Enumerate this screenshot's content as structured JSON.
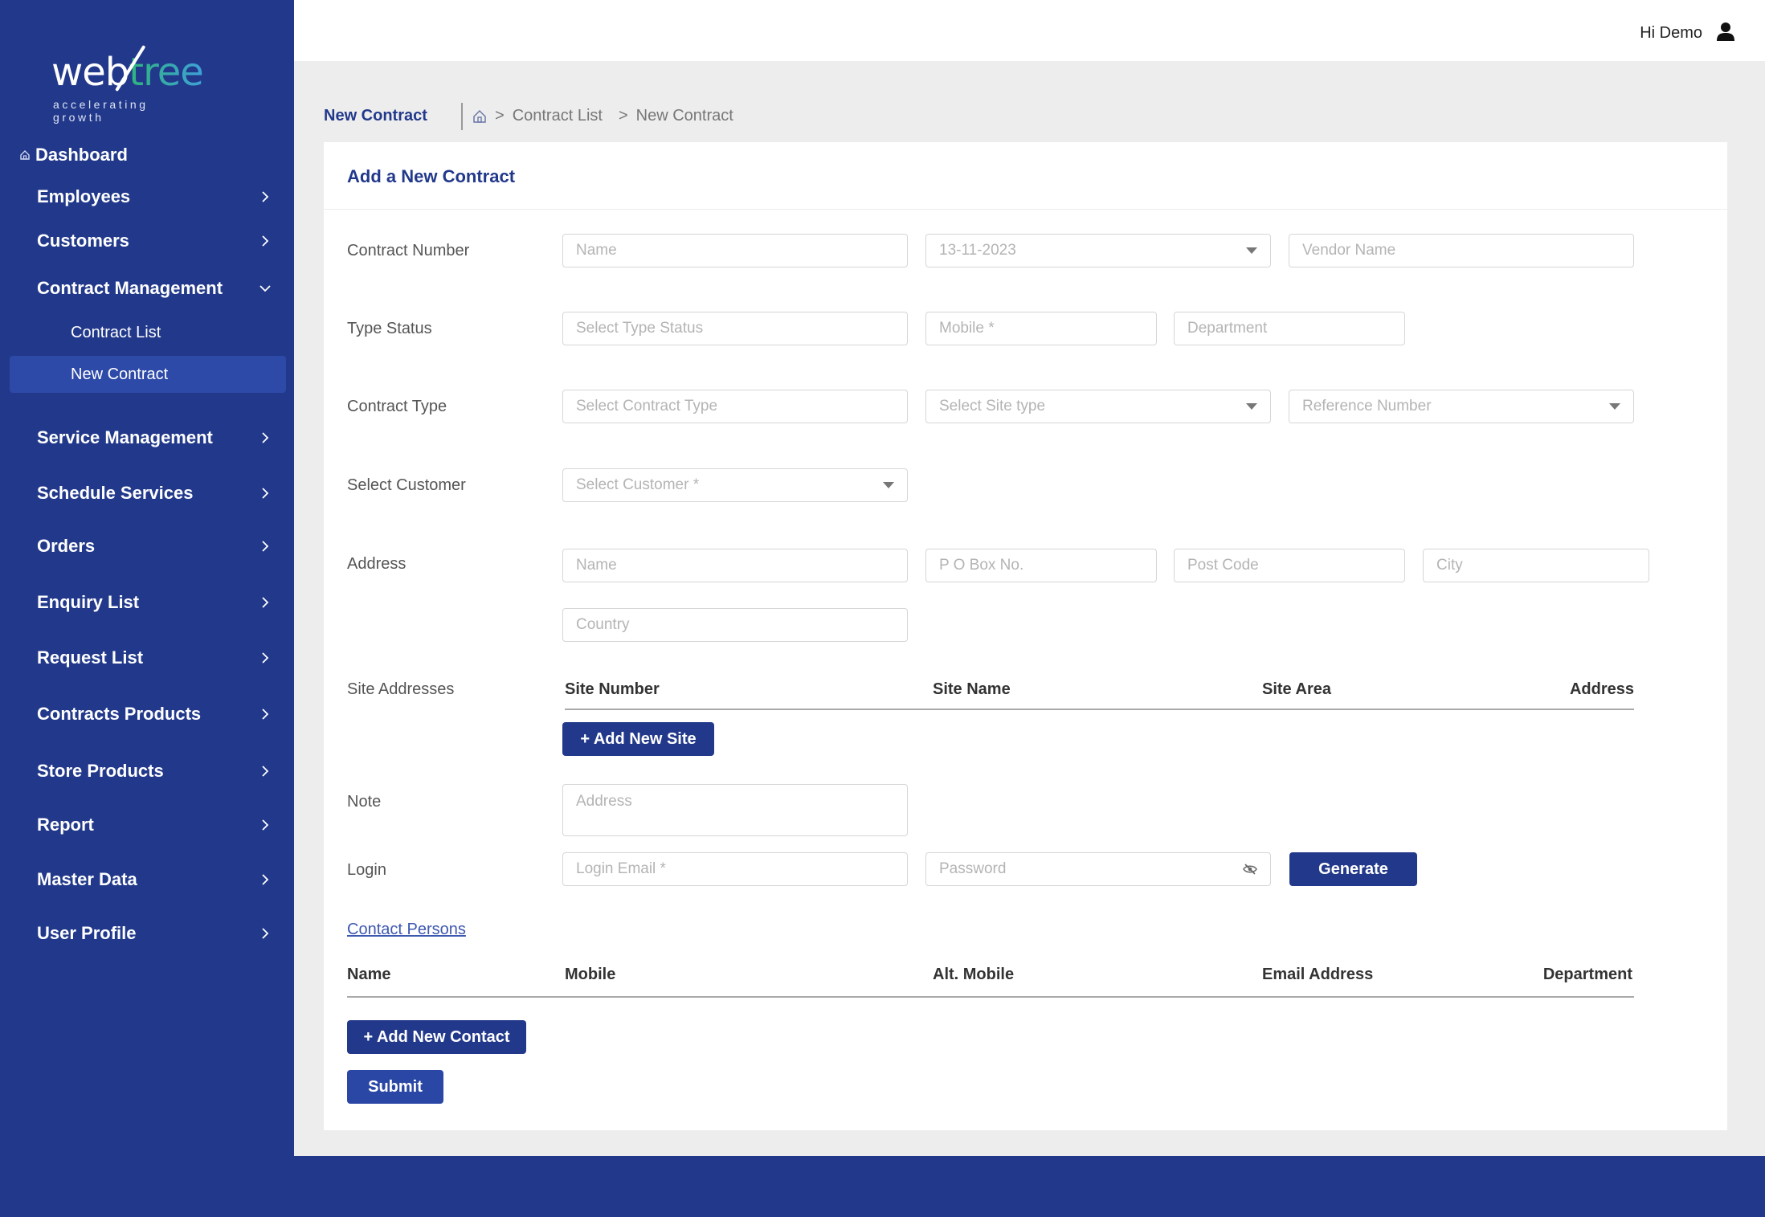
{
  "brand": {
    "name_part1": "web",
    "name_part2": "tree",
    "tagline": "accelerating growth"
  },
  "colors": {
    "primary": "#22398b",
    "active_bg": "#2e4aa8",
    "page_bg": "#ededed"
  },
  "header": {
    "greeting": "Hi Demo",
    "user_icon": "user-icon"
  },
  "sidebar": {
    "dashboard": "Dashboard",
    "items": [
      {
        "label": "Employees",
        "icon": "chevron-right-icon"
      },
      {
        "label": "Customers",
        "icon": "chevron-right-icon"
      },
      {
        "label": "Contract Management",
        "icon": "chevron-down-icon",
        "expanded": true
      },
      {
        "label": "Service Management",
        "icon": "chevron-right-icon"
      },
      {
        "label": "Schedule Services",
        "icon": "chevron-right-icon"
      },
      {
        "label": "Orders",
        "icon": "chevron-right-icon"
      },
      {
        "label": "Enquiry List",
        "icon": "chevron-right-icon"
      },
      {
        "label": "Request List",
        "icon": "chevron-right-icon"
      },
      {
        "label": "Contracts Products",
        "icon": "chevron-right-icon"
      },
      {
        "label": "Store Products",
        "icon": "chevron-right-icon"
      },
      {
        "label": "Report",
        "icon": "chevron-right-icon"
      },
      {
        "label": "Master Data",
        "icon": "chevron-right-icon"
      },
      {
        "label": "User Profile",
        "icon": "chevron-right-icon"
      }
    ],
    "sub_items": [
      {
        "label": "Contract List",
        "active": false
      },
      {
        "label": "New Contract",
        "active": true
      }
    ]
  },
  "breadcrumb": {
    "page_title": "New Contract",
    "items": [
      "Contract List",
      "New Contract"
    ],
    "separator": ">"
  },
  "form": {
    "title": "Add a New Contract",
    "labels": {
      "contract_number": "Contract Number",
      "type_status": "Type Status",
      "contract_type": "Contract Type",
      "select_customer": "Select Customer",
      "address": "Address",
      "site_addresses": "Site Addresses",
      "note": "Note",
      "login": "Login"
    },
    "fields": {
      "contract_name": {
        "placeholder": "Name"
      },
      "date": {
        "value": "13-11-2023"
      },
      "vendor_name": {
        "placeholder": "Vendor Name"
      },
      "type_status": {
        "placeholder": "Select Type Status"
      },
      "mobile": {
        "placeholder": "Mobile *"
      },
      "department": {
        "placeholder": "Department"
      },
      "contract_type": {
        "placeholder": "Select Contract Type"
      },
      "site_type": {
        "placeholder": "Select Site type"
      },
      "reference_number": {
        "placeholder": "Reference Number"
      },
      "customer": {
        "placeholder": "Select Customer *"
      },
      "address_name": {
        "placeholder": "Name"
      },
      "po_box": {
        "placeholder": "P O Box No."
      },
      "post_code": {
        "placeholder": "Post Code"
      },
      "city": {
        "placeholder": "City"
      },
      "country": {
        "placeholder": "Country"
      },
      "note": {
        "placeholder": "Address"
      },
      "login_email": {
        "placeholder": "Login Email *"
      },
      "password": {
        "placeholder": "Password"
      }
    },
    "site_table": {
      "columns": [
        "Site Number",
        "Site Name",
        "Site Area",
        "Address"
      ]
    },
    "buttons": {
      "add_site": "+ Add New Site",
      "generate": "Generate",
      "add_contact": "+ Add New Contact",
      "submit": "Submit"
    },
    "contact_persons_link": "Contact Persons",
    "contact_table": {
      "columns": [
        "Name",
        "Mobile",
        "Alt. Mobile",
        "Email Address",
        "Department"
      ]
    }
  }
}
